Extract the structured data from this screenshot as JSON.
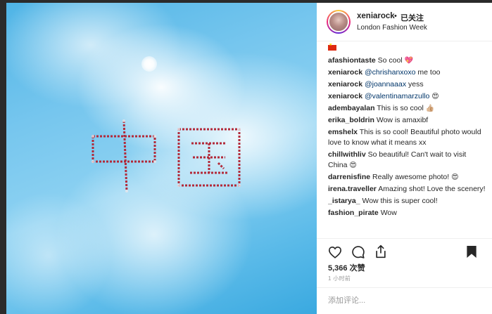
{
  "header": {
    "username": "xeniarock",
    "dot": "•",
    "follow_label": "已关注",
    "location": "London Fashion Week"
  },
  "comments": [
    {
      "user": "afashiontaste",
      "text": "So cool",
      "emoji": "💖"
    },
    {
      "user": "xeniarock",
      "mention": "@chrishanxoxo",
      "text": "me too"
    },
    {
      "user": "xeniarock",
      "mention": "@joannaaax",
      "text": "yess"
    },
    {
      "user": "xeniarock",
      "mention": "@valentinamarzullo",
      "text": "",
      "emoji": "😍"
    },
    {
      "user": "adembayalan",
      "text": "This is so cool",
      "emoji": "👍🏼"
    },
    {
      "user": "erika_boldrin",
      "text": "Wow is amaxibf"
    },
    {
      "user": "emshelx",
      "text": "This is so cool! Beautiful photo would love to know what it means xx"
    },
    {
      "user": "chillwithliv",
      "text": "So beautiful! Can't wait to visit China",
      "emoji": "😍"
    },
    {
      "user": "darrenisfine",
      "text": "Really awesome photo!",
      "emoji": "😍"
    },
    {
      "user": "irena.traveller",
      "text": "Amazing shot! Love the scenery!"
    },
    {
      "user": "_istarya_",
      "text": "Wow this is super cool!"
    },
    {
      "user": "fashion_pirate",
      "text": "Wow"
    }
  ],
  "likes": "5,366 次赞",
  "time": "1 小时前",
  "add_comment_placeholder": "添加评论...",
  "colors": {
    "accent": "#262626",
    "flag": "#de2910",
    "mention": "#003569"
  },
  "icons": [
    "heart-icon",
    "comment-icon",
    "share-icon",
    "bookmark-icon",
    "flag-icon"
  ]
}
